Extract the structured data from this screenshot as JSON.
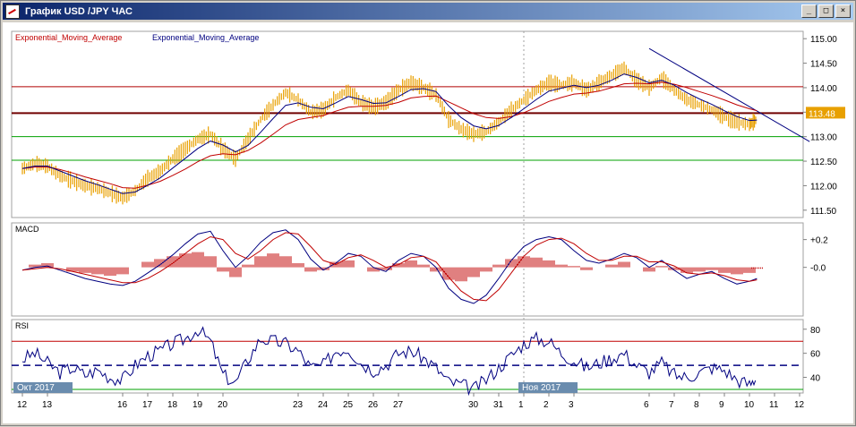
{
  "window": {
    "title": "График USD /JPY  ЧАС",
    "buttons": {
      "minimize": "_",
      "maximize": "□",
      "close": "×"
    }
  },
  "legend": {
    "items": [
      {
        "label": "Exponential_Moving_Average",
        "color": "#c00000"
      },
      {
        "label": "Exponential_Moving_Average",
        "color": "#000080"
      }
    ]
  },
  "chart_data": [
    {
      "type": "line",
      "pane": "price",
      "ylim": [
        111.35,
        115.15
      ],
      "yticks": [
        "115.00",
        "114.50",
        "114.00",
        "113.50",
        "113.00",
        "112.50",
        "112.00",
        "111.50"
      ],
      "ytick_values": [
        115.0,
        114.5,
        114.0,
        113.5,
        113.0,
        112.5,
        112.0,
        111.5
      ],
      "last_price_label": "113.48",
      "last_price": 113.48,
      "hlines": [
        {
          "value": 114.02,
          "color": "#b00000"
        },
        {
          "value": 113.48,
          "color": "#700000"
        },
        {
          "value": 113.0,
          "color": "#00a000"
        },
        {
          "value": 112.52,
          "color": "#00a000"
        }
      ],
      "trendline": {
        "from": [
          6.0,
          114.8
        ],
        "to": [
          12.4,
          112.9
        ]
      },
      "series": [
        {
          "color": "#e8a000",
          "x": [
            12.0,
            12.5,
            13.0,
            13.5,
            14.0,
            14.5,
            15.0,
            15.5,
            16.0,
            16.5,
            17.0,
            17.5,
            18.0,
            18.5,
            19.0,
            19.5,
            20.0,
            20.5,
            21.0,
            21.5,
            22.0,
            22.5,
            23.0,
            23.5,
            24.0,
            24.5,
            25.0,
            25.5,
            26.0,
            26.5,
            27.0,
            27.5,
            28.0,
            28.5,
            29.0,
            29.5,
            30.0,
            30.5,
            31.0,
            31.5,
            1.0,
            1.5,
            2.0,
            2.5,
            3.0,
            3.5,
            4.0,
            4.5,
            5.0,
            5.5,
            6.0,
            6.5,
            7.0,
            7.5,
            8.0,
            8.5,
            9.0,
            9.5,
            10.0,
            10.3
          ],
          "values": [
            112.35,
            112.45,
            112.4,
            112.2,
            112.1,
            112.0,
            111.95,
            111.85,
            111.75,
            111.9,
            112.15,
            112.3,
            112.55,
            112.75,
            112.95,
            113.05,
            112.75,
            112.55,
            112.95,
            113.35,
            113.65,
            113.9,
            113.75,
            113.5,
            113.55,
            113.8,
            113.95,
            113.7,
            113.6,
            113.7,
            113.95,
            114.1,
            114.0,
            113.85,
            113.35,
            113.15,
            113.05,
            113.1,
            113.3,
            113.55,
            113.75,
            113.95,
            114.1,
            114.05,
            114.1,
            113.95,
            114.1,
            114.25,
            114.4,
            114.15,
            114.0,
            114.2,
            113.95,
            113.75,
            113.65,
            113.55,
            113.4,
            113.3,
            113.25,
            113.35
          ]
        },
        {
          "color": "#c00000",
          "x": [
            12.0,
            12.5,
            13.0,
            13.5,
            14.0,
            14.5,
            15.0,
            15.5,
            16.0,
            16.5,
            17.0,
            17.5,
            18.0,
            18.5,
            19.0,
            19.5,
            20.0,
            20.5,
            21.0,
            21.5,
            22.0,
            22.5,
            23.0,
            23.5,
            24.0,
            24.5,
            25.0,
            25.5,
            26.0,
            26.5,
            27.0,
            27.5,
            28.0,
            28.5,
            29.0,
            29.5,
            30.0,
            30.5,
            31.0,
            31.5,
            1.0,
            1.5,
            2.0,
            2.5,
            3.0,
            3.5,
            4.0,
            4.5,
            5.0,
            5.5,
            6.0,
            6.5,
            7.0,
            7.5,
            8.0,
            8.5,
            9.0,
            9.5,
            10.0,
            10.3
          ],
          "values": [
            112.35,
            112.38,
            112.38,
            112.33,
            112.26,
            112.18,
            112.11,
            112.04,
            111.96,
            111.95,
            112.01,
            112.09,
            112.21,
            112.34,
            112.49,
            112.61,
            112.65,
            112.63,
            112.72,
            112.87,
            113.05,
            113.24,
            113.35,
            113.39,
            113.43,
            113.52,
            113.6,
            113.62,
            113.62,
            113.64,
            113.7,
            113.79,
            113.82,
            113.83,
            113.71,
            113.59,
            113.47,
            113.39,
            113.37,
            113.41,
            113.49,
            113.6,
            113.72,
            113.8,
            113.87,
            113.89,
            113.93,
            114.0,
            114.08,
            114.09,
            114.08,
            114.11,
            114.07,
            114.0,
            113.92,
            113.84,
            113.75,
            113.65,
            113.57,
            113.53
          ]
        },
        {
          "color": "#000080",
          "x": [
            12.0,
            12.5,
            13.0,
            13.5,
            14.0,
            14.5,
            15.0,
            15.5,
            16.0,
            16.5,
            17.0,
            17.5,
            18.0,
            18.5,
            19.0,
            19.5,
            20.0,
            20.5,
            21.0,
            21.5,
            22.0,
            22.5,
            23.0,
            23.5,
            24.0,
            24.5,
            25.0,
            25.5,
            26.0,
            26.5,
            27.0,
            27.5,
            28.0,
            28.5,
            29.0,
            29.5,
            30.0,
            30.5,
            31.0,
            31.5,
            1.0,
            1.5,
            2.0,
            2.5,
            3.0,
            3.5,
            4.0,
            4.5,
            5.0,
            5.5,
            6.0,
            6.5,
            7.0,
            7.5,
            8.0,
            8.5,
            9.0,
            9.5,
            10.0,
            10.3
          ],
          "values": [
            112.35,
            112.4,
            112.4,
            112.3,
            112.2,
            112.1,
            112.02,
            111.93,
            111.84,
            111.87,
            112.01,
            112.16,
            112.36,
            112.56,
            112.76,
            112.91,
            112.83,
            112.69,
            112.82,
            113.09,
            113.37,
            113.64,
            113.69,
            113.6,
            113.57,
            113.69,
            113.82,
            113.76,
            113.68,
            113.69,
            113.82,
            113.96,
            113.98,
            113.92,
            113.63,
            113.39,
            113.22,
            113.16,
            113.23,
            113.39,
            113.57,
            113.76,
            113.93,
            113.99,
            114.05,
            114.0,
            114.05,
            114.15,
            114.28,
            114.21,
            114.1,
            114.15,
            114.05,
            113.9,
            113.77,
            113.66,
            113.53,
            113.41,
            113.33,
            113.34
          ]
        }
      ]
    },
    {
      "type": "bar",
      "pane": "macd",
      "title": "MACD",
      "ylim": [
        -0.35,
        0.32
      ],
      "yticks": [
        "+0.2",
        "-0.0"
      ],
      "ytick_values": [
        0.2,
        0.0
      ],
      "x": [
        12.0,
        12.5,
        13.0,
        13.5,
        14.0,
        14.5,
        15.0,
        15.5,
        16.0,
        16.5,
        17.0,
        17.5,
        18.0,
        18.5,
        19.0,
        19.5,
        20.0,
        20.5,
        21.0,
        21.5,
        22.0,
        22.5,
        23.0,
        23.5,
        24.0,
        24.5,
        25.0,
        25.5,
        26.0,
        26.5,
        27.0,
        27.5,
        28.0,
        28.5,
        29.0,
        29.5,
        30.0,
        30.5,
        31.0,
        31.5,
        1.0,
        1.5,
        2.0,
        2.5,
        3.0,
        3.5,
        4.0,
        4.5,
        5.0,
        5.5,
        6.0,
        6.5,
        7.0,
        7.5,
        8.0,
        8.5,
        9.0,
        9.5,
        10.0,
        10.3
      ],
      "histogram": [
        0.0,
        0.02,
        0.03,
        0.0,
        -0.03,
        -0.04,
        -0.05,
        -0.06,
        -0.05,
        0.0,
        0.04,
        0.06,
        0.08,
        0.1,
        0.11,
        0.08,
        -0.03,
        -0.07,
        0.02,
        0.08,
        0.1,
        0.08,
        0.03,
        -0.03,
        -0.02,
        0.04,
        0.05,
        0.0,
        -0.03,
        -0.02,
        0.03,
        0.05,
        0.02,
        -0.03,
        -0.09,
        -0.1,
        -0.07,
        -0.03,
        0.02,
        0.06,
        0.08,
        0.07,
        0.05,
        0.02,
        0.01,
        -0.02,
        0.0,
        0.02,
        0.04,
        0.0,
        -0.03,
        0.01,
        -0.02,
        -0.04,
        -0.03,
        -0.02,
        -0.04,
        -0.05,
        -0.04,
        -0.01
      ],
      "series": [
        {
          "color": "#000080",
          "values": [
            -0.02,
            0.0,
            0.01,
            -0.02,
            -0.05,
            -0.08,
            -0.1,
            -0.12,
            -0.13,
            -0.1,
            -0.04,
            0.02,
            0.09,
            0.17,
            0.24,
            0.26,
            0.12,
            0.0,
            0.08,
            0.18,
            0.25,
            0.27,
            0.2,
            0.06,
            -0.02,
            0.03,
            0.1,
            0.08,
            0.0,
            -0.03,
            0.05,
            0.1,
            0.08,
            0.0,
            -0.15,
            -0.23,
            -0.26,
            -0.2,
            -0.08,
            0.05,
            0.15,
            0.2,
            0.22,
            0.2,
            0.12,
            0.05,
            0.03,
            0.06,
            0.1,
            0.07,
            0.0,
            0.05,
            -0.02,
            -0.08,
            -0.05,
            -0.03,
            -0.08,
            -0.12,
            -0.1,
            -0.08
          ]
        },
        {
          "color": "#c00000",
          "values": [
            -0.02,
            -0.01,
            0.0,
            -0.01,
            -0.03,
            -0.05,
            -0.07,
            -0.09,
            -0.11,
            -0.11,
            -0.08,
            -0.03,
            0.03,
            0.1,
            0.17,
            0.22,
            0.2,
            0.1,
            0.06,
            0.12,
            0.2,
            0.25,
            0.24,
            0.15,
            0.05,
            0.02,
            0.07,
            0.09,
            0.05,
            0.0,
            0.02,
            0.07,
            0.08,
            0.04,
            -0.07,
            -0.17,
            -0.23,
            -0.24,
            -0.16,
            -0.04,
            0.08,
            0.16,
            0.2,
            0.21,
            0.17,
            0.1,
            0.05,
            0.05,
            0.08,
            0.08,
            0.04,
            0.04,
            0.01,
            -0.04,
            -0.05,
            -0.04,
            -0.06,
            -0.09,
            -0.1,
            -0.09
          ]
        }
      ]
    },
    {
      "type": "line",
      "pane": "rsi",
      "title": "RSI",
      "ylim": [
        27,
        88
      ],
      "yticks": [
        "80",
        "60",
        "40"
      ],
      "ytick_values": [
        80,
        60,
        40
      ],
      "levels": [
        {
          "value": 70,
          "color": "#c00000"
        },
        {
          "value": 50,
          "color": "#000080",
          "dashed": true
        },
        {
          "value": 30,
          "color": "#00a000"
        }
      ],
      "x": [
        12.0,
        12.5,
        13.0,
        13.5,
        14.0,
        14.5,
        15.0,
        15.5,
        16.0,
        16.5,
        17.0,
        17.5,
        18.0,
        18.5,
        19.0,
        19.5,
        20.0,
        20.5,
        21.0,
        21.5,
        22.0,
        22.5,
        23.0,
        23.5,
        24.0,
        24.5,
        25.0,
        25.5,
        26.0,
        26.5,
        27.0,
        27.5,
        28.0,
        28.5,
        29.0,
        29.5,
        30.0,
        30.5,
        31.0,
        31.5,
        1.0,
        1.5,
        2.0,
        2.5,
        3.0,
        3.5,
        4.0,
        4.5,
        5.0,
        5.5,
        6.0,
        6.5,
        7.0,
        7.5,
        8.0,
        8.5,
        9.0,
        9.5,
        10.0,
        10.3
      ],
      "series": [
        {
          "color": "#000080",
          "values": [
            55,
            60,
            52,
            44,
            48,
            42,
            46,
            40,
            38,
            50,
            58,
            62,
            68,
            72,
            80,
            70,
            42,
            35,
            55,
            72,
            70,
            68,
            62,
            48,
            50,
            62,
            64,
            52,
            46,
            50,
            60,
            62,
            56,
            48,
            36,
            34,
            30,
            38,
            48,
            58,
            68,
            72,
            70,
            60,
            54,
            48,
            52,
            56,
            60,
            50,
            44,
            52,
            42,
            40,
            44,
            48,
            46,
            38,
            34,
            40
          ]
        }
      ]
    }
  ],
  "xaxis": {
    "ticks": [
      {
        "label": "12",
        "x": 12.0
      },
      {
        "label": "13",
        "x": 13.0
      },
      {
        "label": "16",
        "x": 16.0
      },
      {
        "label": "17",
        "x": 17.0
      },
      {
        "label": "18",
        "x": 18.0
      },
      {
        "label": "19",
        "x": 19.0
      },
      {
        "label": "20",
        "x": 20.0
      },
      {
        "label": "23",
        "x": 23.0
      },
      {
        "label": "24",
        "x": 24.0
      },
      {
        "label": "25",
        "x": 25.0
      },
      {
        "label": "26",
        "x": 26.0
      },
      {
        "label": "27",
        "x": 27.0
      },
      {
        "label": "30",
        "x": 30.0
      },
      {
        "label": "31",
        "x": 31.0
      },
      {
        "label": "1",
        "x": 1.0
      },
      {
        "label": "2",
        "x": 2.0
      },
      {
        "label": "3",
        "x": 3.0
      },
      {
        "label": "6",
        "x": 6.0
      },
      {
        "label": "7",
        "x": 7.0
      },
      {
        "label": "8",
        "x": 8.0
      },
      {
        "label": "9",
        "x": 9.0
      },
      {
        "label": "10",
        "x": 10.0
      },
      {
        "label": "11",
        "x": 11.0
      },
      {
        "label": "12",
        "x": 12.0
      }
    ],
    "period_labels": [
      {
        "label": "Окт 2017",
        "color": "#6a8cae"
      },
      {
        "label": "Ноя 2017",
        "color": "#6a8cae"
      }
    ]
  }
}
